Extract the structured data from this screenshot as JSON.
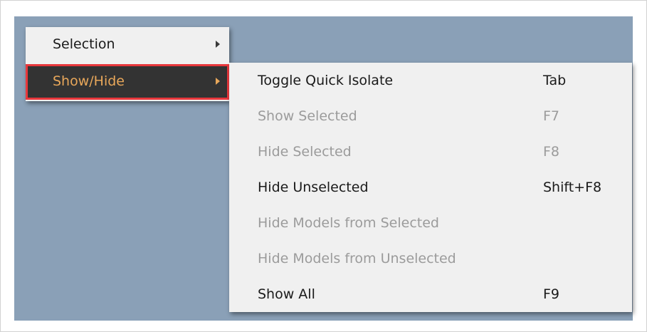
{
  "context_menu": {
    "items": [
      {
        "label": "Selection"
      },
      {
        "label": "Show/Hide"
      }
    ]
  },
  "submenu": {
    "items": [
      {
        "label": "Toggle Quick Isolate",
        "shortcut": "Tab",
        "enabled": true
      },
      {
        "label": "Show Selected",
        "shortcut": "F7",
        "enabled": false
      },
      {
        "label": "Hide Selected",
        "shortcut": "F8",
        "enabled": false
      },
      {
        "label": "Hide Unselected",
        "shortcut": "Shift+F8",
        "enabled": true
      },
      {
        "label": "Hide Models from Selected",
        "shortcut": "",
        "enabled": false
      },
      {
        "label": "Hide Models from Unselected",
        "shortcut": "",
        "enabled": false
      },
      {
        "label": "Show All",
        "shortcut": "F9",
        "enabled": true
      }
    ]
  },
  "colors": {
    "viewport_background": "#8aa0b7",
    "menu_background": "#f0f0f0",
    "highlight_background": "#333333",
    "highlight_text": "#e8a75a",
    "highlight_border": "#e8373c",
    "disabled_text": "#9b9b9b"
  }
}
